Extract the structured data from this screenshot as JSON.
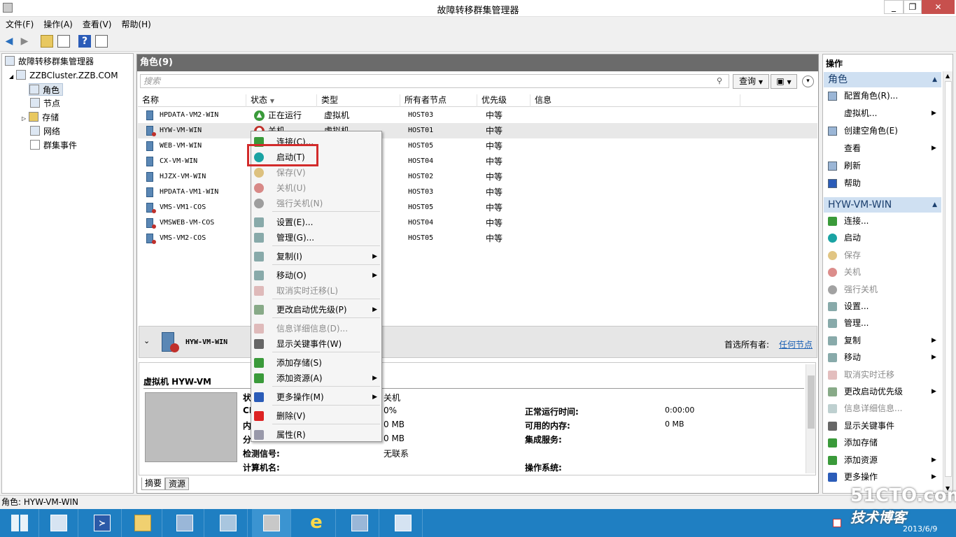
{
  "window": {
    "title": "故障转移群集管理器",
    "controls": [
      "_",
      "❐",
      "✕"
    ]
  },
  "menu": [
    "文件(F)",
    "操作(A)",
    "查看(V)",
    "帮助(H)"
  ],
  "tree": {
    "root": "故障转移群集管理器",
    "cluster": "ZZBCluster.ZZB.COM",
    "items": [
      "角色",
      "节点",
      "存储",
      "网络",
      "群集事件"
    ]
  },
  "center": {
    "header": "角色(9)",
    "search_placeholder": "搜索",
    "query_label": "查询",
    "columns": [
      "名称",
      "状态",
      "类型",
      "所有者节点",
      "优先级",
      "信息"
    ],
    "rows": [
      {
        "name": "HPDATA-VM2-WIN",
        "status": "正在运行",
        "type": "虚拟机",
        "owner": "HOST03",
        "priority": "中等"
      },
      {
        "name": "HYW-VM-WIN",
        "status": "关机",
        "type": "虚拟机",
        "owner": "HOST01",
        "priority": "中等"
      },
      {
        "name": "WEB-VM-WIN",
        "status": "",
        "type": "",
        "owner": "HOST05",
        "priority": "中等"
      },
      {
        "name": "CX-VM-WIN",
        "status": "",
        "type": "",
        "owner": "HOST04",
        "priority": "中等"
      },
      {
        "name": "HJZX-VM-WIN",
        "status": "",
        "type": "",
        "owner": "HOST02",
        "priority": "中等"
      },
      {
        "name": "HPDATA-VM1-WIN",
        "status": "",
        "type": "",
        "owner": "HOST03",
        "priority": "中等"
      },
      {
        "name": "VMS-VM1-COS",
        "status": "",
        "type": "",
        "owner": "HOST05",
        "priority": "中等"
      },
      {
        "name": "VMSWEB-VM-COS",
        "status": "",
        "type": "",
        "owner": "HOST04",
        "priority": "中等"
      },
      {
        "name": "VMS-VM2-COS",
        "status": "",
        "type": "",
        "owner": "HOST05",
        "priority": "中等"
      }
    ]
  },
  "detail": {
    "vm_name": "HYW-VM-WIN",
    "preferred_owner_label": "首选所有者:",
    "preferred_owner_link": "任何节点",
    "section_title": "虚拟机 HYW-VM",
    "left_labels": [
      "状",
      "CP",
      "内",
      "分",
      "检测信号:",
      "计算机名:"
    ],
    "left_values": [
      "关机",
      "0%",
      "0 MB",
      "0 MB",
      "无联系",
      ""
    ],
    "right_labels": [
      "正常运行时间:",
      "可用的内存:",
      "集成服务:",
      "操作系统:"
    ],
    "right_values": [
      "0:00:00",
      "0 MB",
      "",
      ""
    ],
    "tabs": [
      "摘要",
      "资源"
    ]
  },
  "context_menu": [
    {
      "label": "连接(C)...",
      "disabled": false
    },
    {
      "label": "启动(T)",
      "disabled": false
    },
    {
      "label": "保存(V)",
      "disabled": true
    },
    {
      "label": "关机(U)",
      "disabled": true
    },
    {
      "label": "强行关机(N)",
      "disabled": true
    },
    {
      "label": "设置(E)...",
      "disabled": false
    },
    {
      "label": "管理(G)...",
      "disabled": false
    },
    {
      "label": "复制(I)",
      "disabled": false
    },
    {
      "label": "移动(O)",
      "disabled": false
    },
    {
      "label": "取消实时迁移(L)",
      "disabled": true
    },
    {
      "label": "更改启动优先级(P)",
      "disabled": false
    },
    {
      "label": "信息详细信息(D)...",
      "disabled": true
    },
    {
      "label": "显示关键事件(W)",
      "disabled": false
    },
    {
      "label": "添加存储(S)",
      "disabled": false
    },
    {
      "label": "添加资源(A)",
      "disabled": false
    },
    {
      "label": "更多操作(M)",
      "disabled": false
    },
    {
      "label": "删除(V)",
      "disabled": false
    },
    {
      "label": "属性(R)",
      "disabled": false
    }
  ],
  "actions": {
    "title": "操作",
    "section1": "角色",
    "items1": [
      "配置角色(R)...",
      "虚拟机...",
      "创建空角色(E)",
      "查看",
      "刷新",
      "帮助"
    ],
    "section2": "HYW-VM-WIN",
    "items2": [
      "连接...",
      "启动",
      "保存",
      "关机",
      "强行关机",
      "设置...",
      "管理...",
      "复制",
      "移动",
      "取消实时迁移",
      "更改启动优先级",
      "信息详细信息...",
      "显示关键事件",
      "添加存储",
      "添加资源",
      "更多操作"
    ]
  },
  "statusbar": "角色: HYW-VM-WIN",
  "tray": {
    "date": "2013/6/9"
  },
  "watermark": {
    "line1": "51CTO.com",
    "line2": "技术博客"
  },
  "colors": {
    "accent": "#1f7fc2",
    "highlight_box": "#d22b2b",
    "section_header": "#cfe0f2"
  }
}
